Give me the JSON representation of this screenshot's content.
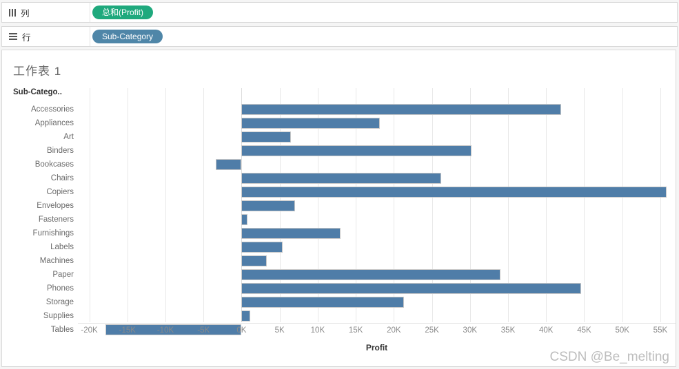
{
  "shelves": {
    "columns": {
      "label": "列",
      "icon": "columns-icon",
      "pill": "总和(Profit)",
      "pill_color": "#1fa97d"
    },
    "rows": {
      "label": "行",
      "icon": "rows-icon",
      "pill": "Sub-Category",
      "pill_color": "#4f86a8"
    }
  },
  "worksheet": {
    "title": "工作表 1",
    "row_header": "Sub-Catego..",
    "watermark": "CSDN @Be_melting"
  },
  "chart_data": {
    "type": "bar",
    "orientation": "horizontal",
    "title": "工作表 1",
    "xlabel": "Profit",
    "ylabel": "Sub-Catego..",
    "xlim": [
      -21500,
      57000
    ],
    "xticks": [
      -20000,
      -15000,
      -10000,
      -5000,
      0,
      5000,
      10000,
      15000,
      20000,
      25000,
      30000,
      35000,
      40000,
      45000,
      50000,
      55000
    ],
    "xticklabels": [
      "-20K",
      "-15K",
      "-10K",
      "-5K",
      "0K",
      "5K",
      "10K",
      "15K",
      "20K",
      "25K",
      "30K",
      "35K",
      "40K",
      "45K",
      "50K",
      "55K"
    ],
    "grid": true,
    "legend": false,
    "bar_color": "#4f7da8",
    "categories": [
      "Accessories",
      "Appliances",
      "Art",
      "Binders",
      "Bookcases",
      "Chairs",
      "Copiers",
      "Envelopes",
      "Fasteners",
      "Furnishings",
      "Labels",
      "Machines",
      "Paper",
      "Phones",
      "Storage",
      "Supplies",
      "Tables"
    ],
    "values": [
      42000,
      18200,
      6500,
      30200,
      -3400,
      26200,
      55800,
      7000,
      800,
      13000,
      5400,
      3300,
      34000,
      44600,
      21300,
      1100,
      -17900
    ]
  }
}
